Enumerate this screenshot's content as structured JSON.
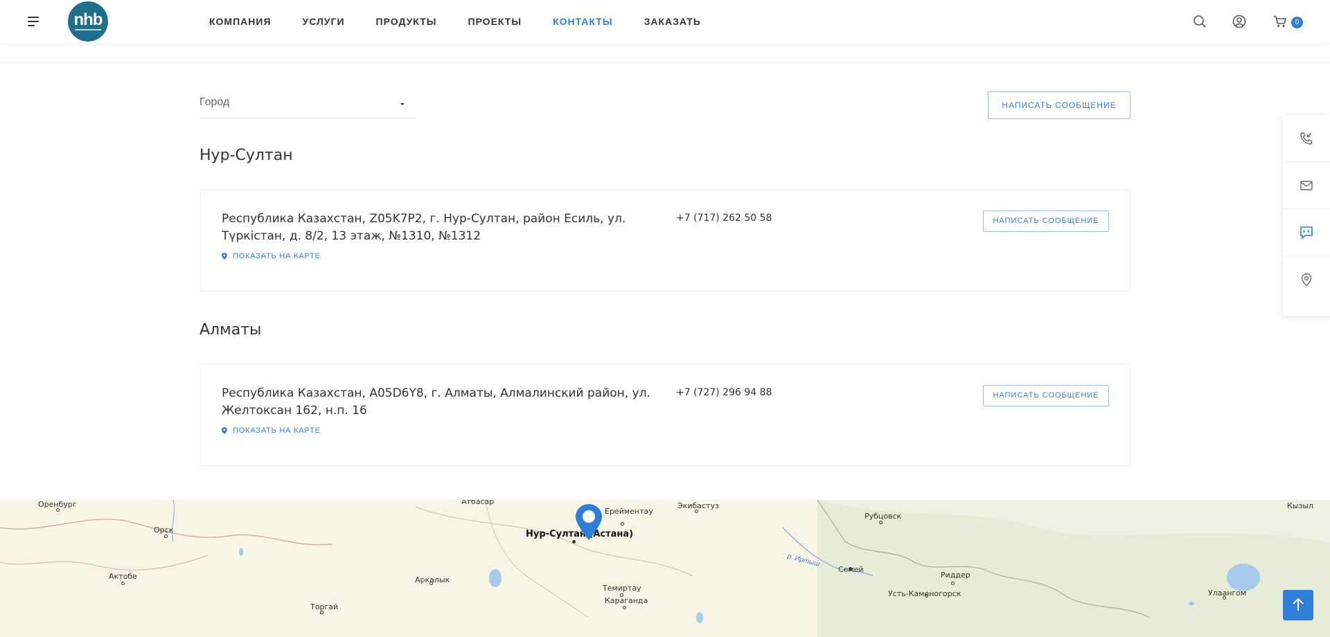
{
  "header": {
    "logo_text": "nhb",
    "nav": [
      "КОМПАНИЯ",
      "УСЛУГИ",
      "ПРОДУКТЫ",
      "ПРОЕКТЫ",
      "КОНТАКТЫ",
      "ЗАКАЗАТЬ"
    ],
    "active_nav": "КОНТАКТЫ",
    "cart_count": "0"
  },
  "filter": {
    "city_placeholder": "Город",
    "write_button": "НАПИСАТЬ СООБЩЕНИЕ"
  },
  "offices": [
    {
      "city": "Нур-Султан",
      "address": "Республика Казахстан, Z05K7P2, г. Нур-Султан, район Есиль, ул. Түркістан, д. 8/2, 13 этаж, №1310, №1312",
      "phone": "+7 (717) 262 50 58",
      "map_link": "ПОКАЗАТЬ НА КАРТЕ",
      "button": "НАПИСАТЬ СООБЩЕНИЕ"
    },
    {
      "city": "Алматы",
      "address": "Республика Казахстан, A05D6Y8, г. Алматы, Алмалинский район, ул. Желтоксан 162, н.п. 16",
      "phone": "+7 (727) 296 94 88",
      "map_link": "ПОКАЗАТЬ НА КАРТЕ",
      "button": "НАПИСАТЬ СООБЩЕНИЕ"
    }
  ],
  "side_panel": [
    "phone-callback-icon",
    "mail-icon",
    "chat-icon",
    "location-pin-icon"
  ],
  "map": {
    "cities": {
      "orenburg": "Оренбург",
      "atbasar": "Атбасар",
      "ereymentau": "Ерейментау",
      "ekibastuz": "Экибастуз",
      "orsk": "Орск",
      "nursultan": "Нур-Султан (Астана)",
      "rubtsovsk": "Рубцовск",
      "kyzyl": "Кызыл",
      "semey": "Семей",
      "aktobe": "Актобе",
      "arkalyk": "Аркалык",
      "ridder": "Риддер",
      "temirtau": "Темиртау",
      "ust_kamenogorsk": "Усть-Каменогорск",
      "ulaangom": "Улаангом",
      "karaganda": "Караганда",
      "torgai": "Торгай"
    },
    "rivers": {
      "irtysh": "р. Иртыш"
    }
  },
  "colors": {
    "accent": "#2f7fd8",
    "logo": "#1f6f8b",
    "map_bg": "#f8f4e6"
  }
}
